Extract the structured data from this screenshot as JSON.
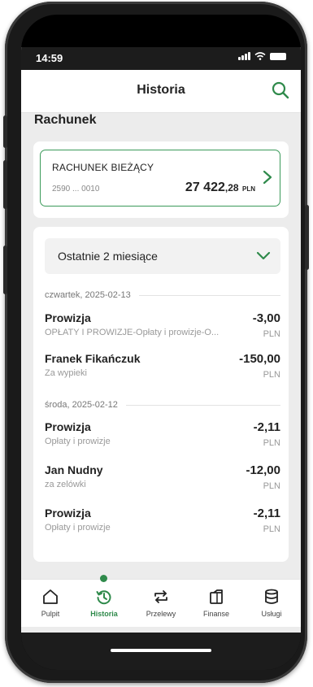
{
  "status": {
    "time": "14:59"
  },
  "header": {
    "title": "Historia",
    "search_icon": "search-icon"
  },
  "section": {
    "label": "Rachunek"
  },
  "account": {
    "name": "RACHUNEK BIEŻĄCY",
    "number": "2590 ... 0010",
    "balance_main": "27 422",
    "balance_dec": ",28",
    "currency": "PLN"
  },
  "filter": {
    "period": "Ostatnie 2 miesiące"
  },
  "groups": [
    {
      "date": "czwartek, 2025-02-13",
      "transactions": [
        {
          "name": "Prowizja",
          "desc": "OPŁATY I PROWIZJE-Opłaty i prowizje-O...",
          "amount": "-3,00",
          "currency": "PLN"
        },
        {
          "name": "Franek Fikańczuk",
          "desc": "Za wypieki",
          "amount": "-150,00",
          "currency": "PLN"
        }
      ]
    },
    {
      "date": "środa, 2025-02-12",
      "transactions": [
        {
          "name": "Prowizja",
          "desc": "Opłaty i prowizje",
          "amount": "-2,11",
          "currency": "PLN"
        },
        {
          "name": "Jan Nudny",
          "desc": "za zelówki",
          "amount": "-12,00",
          "currency": "PLN"
        },
        {
          "name": "Prowizja",
          "desc": "Opłaty i prowizje",
          "amount": "-2,11",
          "currency": "PLN"
        }
      ]
    }
  ],
  "nav": {
    "items": [
      {
        "label": "Pulpit",
        "icon": "home-icon"
      },
      {
        "label": "Historia",
        "icon": "history-icon",
        "active": true
      },
      {
        "label": "Przelewy",
        "icon": "transfer-icon"
      },
      {
        "label": "Finanse",
        "icon": "finance-icon"
      },
      {
        "label": "Usługi",
        "icon": "services-icon"
      }
    ]
  },
  "colors": {
    "accent": "#2f8a4b",
    "border": "#3b9a5a",
    "background": "#ececec"
  }
}
